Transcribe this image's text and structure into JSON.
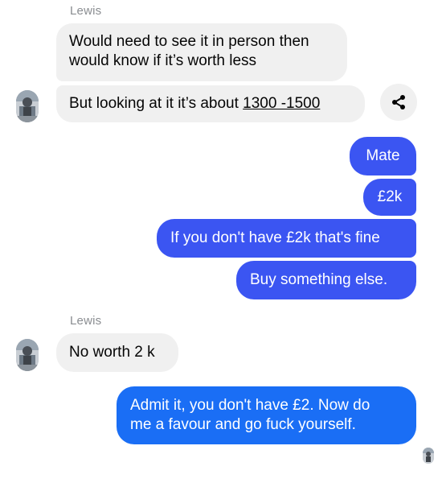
{
  "thread": {
    "group1": {
      "sender": "Lewis",
      "msg1_line1": "Would need to see it in person then",
      "msg1_line2": "would know if it’s worth less",
      "msg2_prefix": "But looking at it it’s about ",
      "msg2_link": "1300 -1500"
    },
    "outgoing": {
      "msg1": "Mate",
      "msg2": "£2k",
      "msg3": "If you don't have £2k that's fine",
      "msg4": "Buy something else."
    },
    "group2": {
      "sender": "Lewis",
      "msg1": "No worth 2 k"
    },
    "final": {
      "line1": "Admit it, you don't have £2. Now do",
      "line2": "me a favour and go fuck yourself."
    }
  },
  "icons": {
    "share": "share-icon",
    "avatar": "contact-avatar"
  },
  "colors": {
    "incoming_bubble": "#f0f0f0",
    "outgoing_bubble": "#3b55f2",
    "outgoing_bubble_last": "#1a6ef5",
    "sender_label": "#8a8d91"
  }
}
